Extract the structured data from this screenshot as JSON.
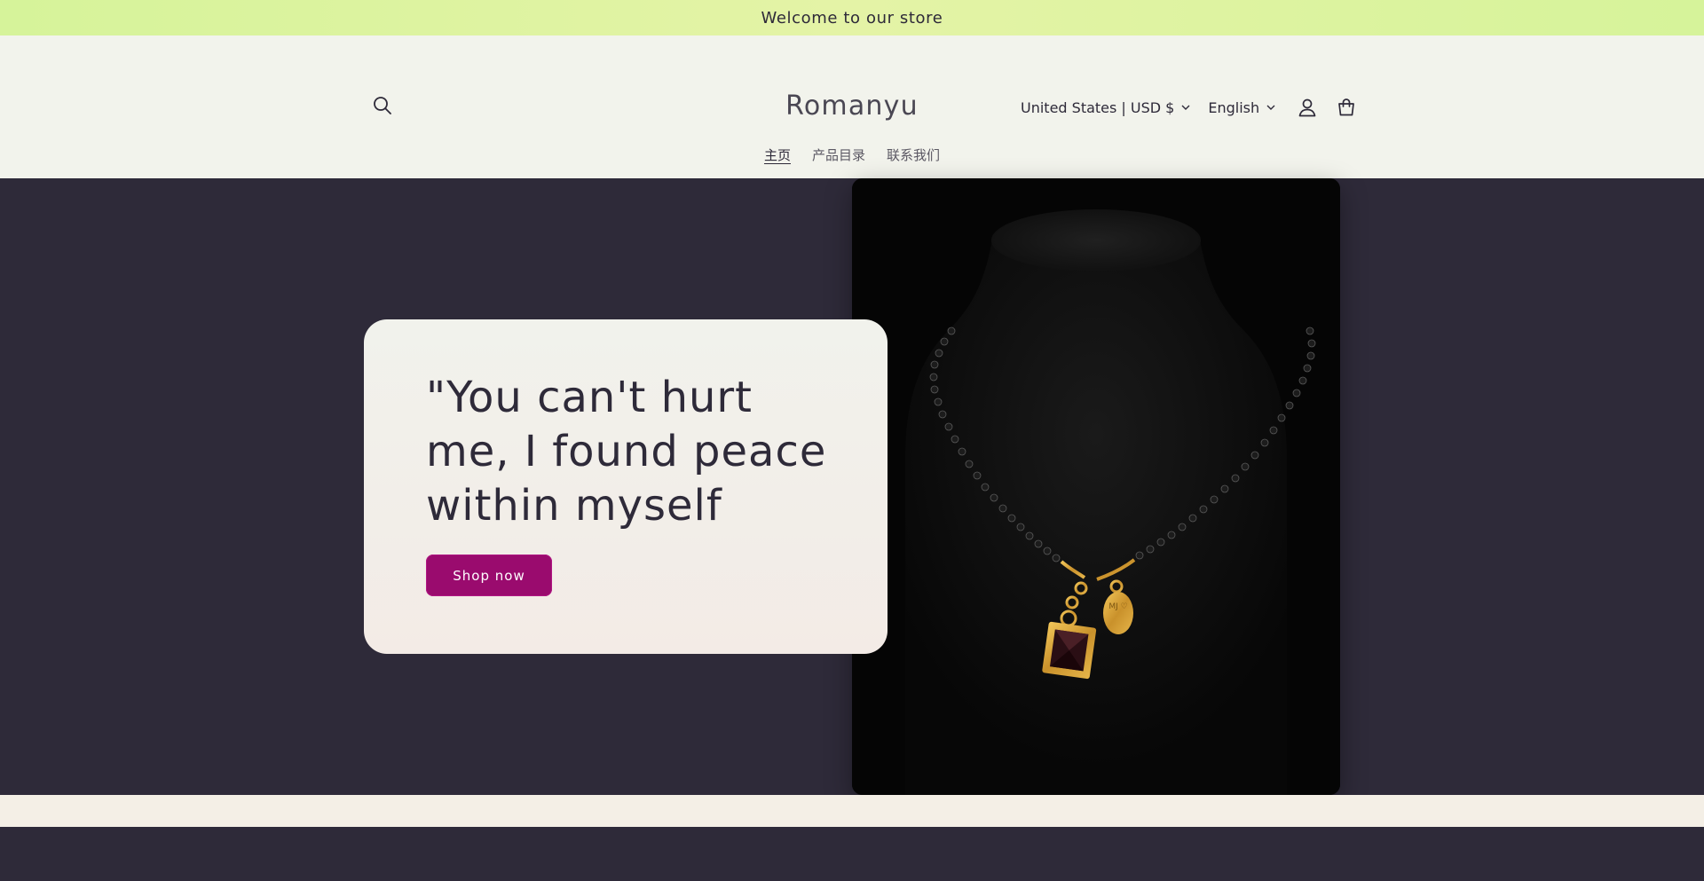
{
  "announcement": {
    "text": "Welcome to our store"
  },
  "header": {
    "logo": "Romanyu",
    "country_selector": "United States | USD $",
    "language_selector": "English",
    "icons": {
      "search": "search-icon",
      "account": "user-icon",
      "cart": "cart-icon",
      "chevron": "chevron-down-icon"
    }
  },
  "nav": {
    "items": [
      {
        "label": "主页",
        "active": true
      },
      {
        "label": "产品目录",
        "active": false
      },
      {
        "label": "联系我们",
        "active": false
      }
    ]
  },
  "hero": {
    "heading": "\"You can't hurt me, I found peace within myself",
    "button_label": "Shop now",
    "image_engraving": "MJ ♡"
  },
  "colors": {
    "announcement_bg": "#e4f3a6",
    "header_bg": "#f2f3ec",
    "hero_bg": "#2e2a39",
    "button_bg": "#9a0b6e",
    "text_dark": "#2e2a39"
  }
}
